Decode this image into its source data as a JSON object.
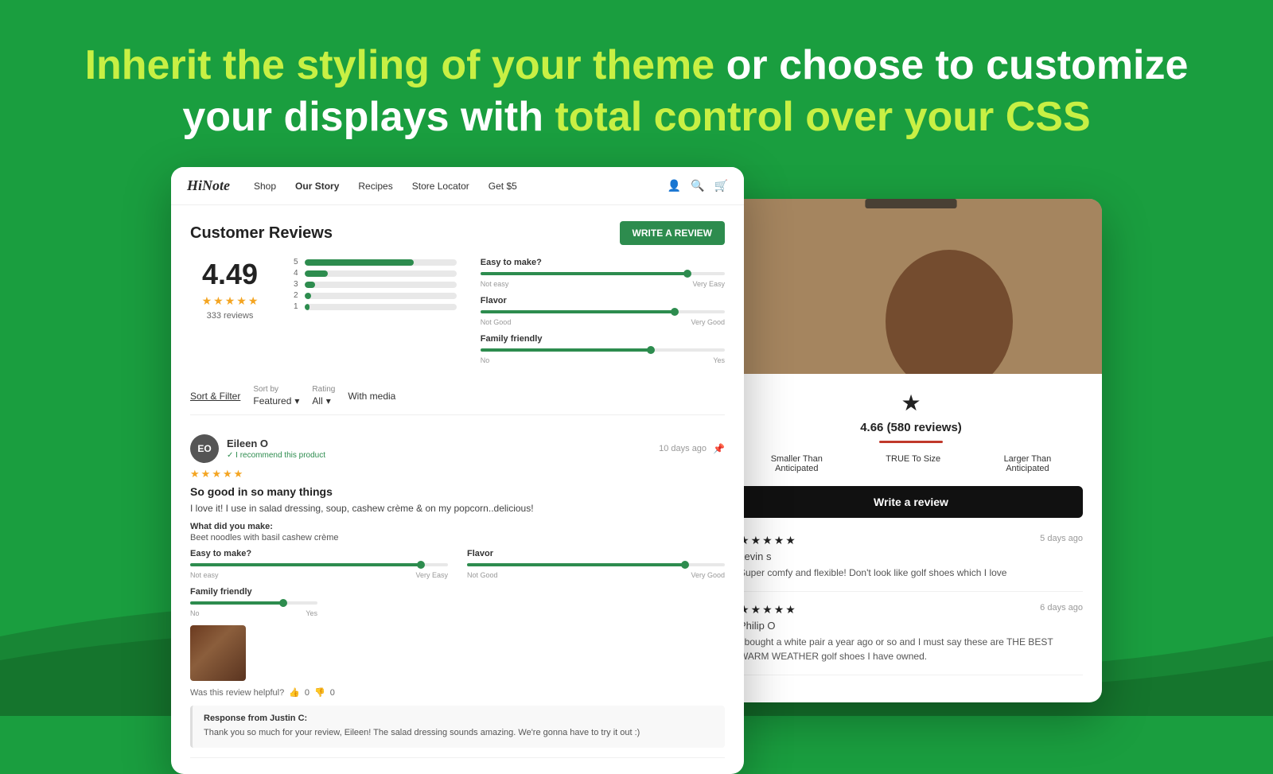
{
  "background_color": "#1a9e3f",
  "headline": {
    "part1": "Inherit the styling of your theme",
    "connector": " or choose to customize",
    "part2": "your displays with ",
    "highlight": "total control over your CSS"
  },
  "left_screenshot": {
    "nav": {
      "logo": "HiNote",
      "links": [
        "Shop",
        "Our Story",
        "Recipes",
        "Store Locator",
        "Get $5"
      ]
    },
    "reviews_section": {
      "title": "Customer Reviews",
      "write_review_btn": "WRITE A REVIEW",
      "overall_rating": "4.49",
      "review_count": "333 reviews",
      "bars": [
        {
          "label": "5",
          "fill_pct": 72
        },
        {
          "label": "4",
          "fill_pct": 15
        },
        {
          "label": "3",
          "fill_pct": 7
        },
        {
          "label": "2",
          "fill_pct": 3
        },
        {
          "label": "1",
          "fill_pct": 3
        }
      ],
      "sliders": [
        {
          "label": "Easy to make?",
          "left_label": "Not easy",
          "right_label": "Very Easy",
          "position_pct": 85
        },
        {
          "label": "Flavor",
          "left_label": "Not Good",
          "right_label": "Very Good",
          "position_pct": 80
        },
        {
          "label": "Family friendly",
          "left_label": "No",
          "right_label": "Yes",
          "position_pct": 70
        }
      ],
      "sort_label": "Sort & Filter",
      "sort_by_label": "Sort by",
      "sort_value": "Featured",
      "rating_label": "Rating",
      "rating_value": "All",
      "with_media": "With media",
      "review": {
        "initials": "EO",
        "name": "Eileen O",
        "verified": "✓ I recommend this product",
        "date": "10 days ago",
        "stars": 5,
        "title": "So good in so many things",
        "body": "I love it! I use in salad dressing, soup, cashew crème & on my popcorn..delicious!",
        "what_made_label": "What did you make:",
        "what_made": "Beet noodles with basil cashew crème",
        "sliders": [
          {
            "label": "Easy to make?",
            "left_label": "Not easy",
            "right_label": "Very Easy",
            "position_pct": 90
          },
          {
            "label": "Flavor",
            "left_label": "Not Good",
            "right_label": "Very Good",
            "position_pct": 85
          }
        ],
        "family_friendly_label": "Family friendly",
        "family_no": "No",
        "family_yes": "Yes",
        "family_pct": 72,
        "helpful_text": "Was this review helpful?",
        "thumbs_up_count": "0",
        "thumbs_down_count": "0",
        "response_from": "Response from Justin C:",
        "response_text": "Thank you so much for your review, Eileen! The salad dressing sounds amazing. We're gonna have to try it out :)"
      }
    }
  },
  "right_screenshot": {
    "rating": "★",
    "rating_text": "4.66 (580 reviews)",
    "fit": [
      {
        "label": "Smaller Than\nAnticipated"
      },
      {
        "label": "TRUE To Size"
      },
      {
        "label": "Larger Than\nAnticipated"
      }
    ],
    "write_review_btn": "Write a review",
    "reviews": [
      {
        "stars": 5,
        "date": "5 days ago",
        "name": "kevin s",
        "text": "Super comfy and flexible! Don't look like golf shoes which I love"
      },
      {
        "stars": 5,
        "date": "6 days ago",
        "name": "Philip O",
        "text": "I bought a white pair a year ago or so and I must say these are THE BEST WARM WEATHER golf shoes I have owned."
      }
    ]
  }
}
